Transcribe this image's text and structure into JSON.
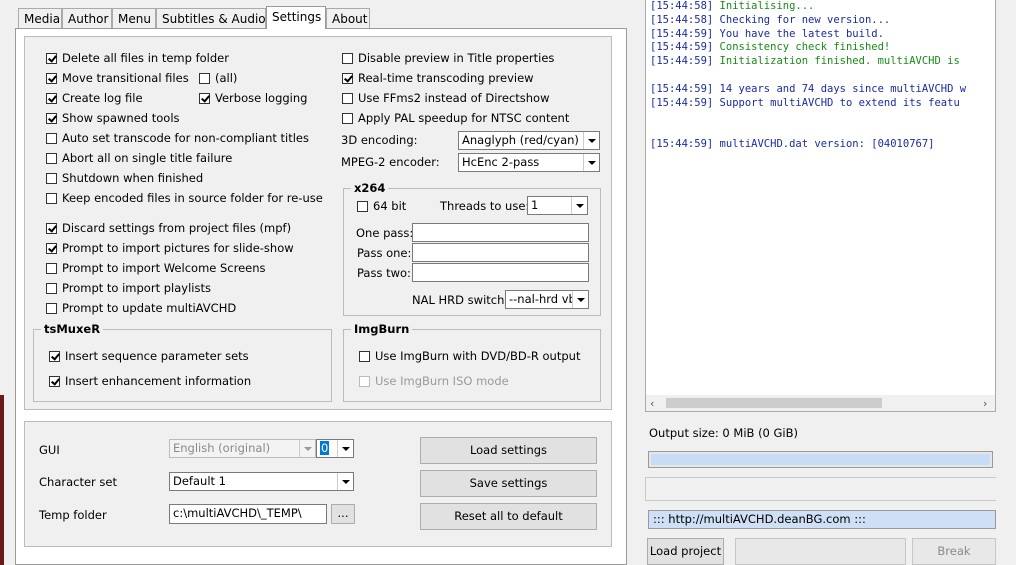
{
  "tabs": [
    "Media",
    "Author",
    "Menu",
    "Subtitles & Audio",
    "Settings",
    "About"
  ],
  "active_tab": "Settings",
  "options_left": [
    {
      "label": "Delete all files in temp folder",
      "checked": true
    },
    {
      "label": "Move transitional files",
      "checked": true
    },
    {
      "label": "Create log file",
      "checked": true
    },
    {
      "label": "Show spawned tools",
      "checked": true
    },
    {
      "label": "Auto set transcode for non-compliant titles",
      "checked": false
    },
    {
      "label": "Abort all on single title failure",
      "checked": false
    },
    {
      "label": "Shutdown when finished",
      "checked": false
    },
    {
      "label": "Keep encoded files in source folder for re-use",
      "checked": false
    },
    {
      "label": "Discard settings from project files (mpf)",
      "checked": true
    },
    {
      "label": "Prompt to import pictures for slide-show",
      "checked": true
    },
    {
      "label": "Prompt to import Welcome Screens",
      "checked": false
    },
    {
      "label": "Prompt to import playlists",
      "checked": false
    },
    {
      "label": "Prompt to update multiAVCHD",
      "checked": false
    }
  ],
  "all_option": {
    "label": "(all)",
    "checked": false
  },
  "verbose_option": {
    "label": "Verbose logging",
    "checked": true
  },
  "options_right": [
    {
      "label": "Disable preview in Title properties",
      "checked": false
    },
    {
      "label": "Real-time transcoding preview",
      "checked": true
    },
    {
      "label": "Use FFms2 instead of Directshow",
      "checked": false
    },
    {
      "label": "Apply PAL speedup for NTSC content",
      "checked": false
    }
  ],
  "encoding_3d": {
    "label": "3D encoding:",
    "value": "Anaglyph (red/cyan)"
  },
  "mpeg2_encoder": {
    "label": "MPEG-2 encoder:",
    "value": "HcEnc 2-pass"
  },
  "x264": {
    "title": "x264",
    "bit64": {
      "label": "64 bit",
      "checked": false
    },
    "threads_label": "Threads to use:",
    "threads_value": "1",
    "one_pass_label": "One pass:",
    "one_pass_value": "",
    "pass_one_label": "Pass one:",
    "pass_one_value": "",
    "pass_two_label": "Pass two:",
    "pass_two_value": "",
    "nal_label": "NAL HRD switch:",
    "nal_value": "--nal-hrd vbr"
  },
  "tsmuxer": {
    "title": "tsMuxeR",
    "items": [
      {
        "label": "Insert sequence parameter sets",
        "checked": true
      },
      {
        "label": "Insert enhancement information",
        "checked": true
      }
    ]
  },
  "imgburn": {
    "title": "ImgBurn",
    "items": [
      {
        "label": "Use ImgBurn with DVD/BD-R output",
        "checked": false,
        "disabled": false
      },
      {
        "label": "Use ImgBurn ISO mode",
        "checked": false,
        "disabled": true
      }
    ]
  },
  "bottom": {
    "gui_label": "GUI",
    "gui_value": "English (original)",
    "gui_num": "0",
    "charset_label": "Character set",
    "charset_value": "Default 1",
    "temp_label": "Temp folder",
    "temp_value": "c:\\multiAVCHD\\_TEMP\\",
    "browse_label": "...",
    "load_settings": "Load settings",
    "save_settings": "Save settings",
    "reset_default": "Reset all to default"
  },
  "log_lines": [
    {
      "time": "[15:44:58]",
      "text": "Initialising...",
      "color": "green"
    },
    {
      "time": "[15:44:58]",
      "text": "Checking for new version...",
      "color": "blue"
    },
    {
      "time": "[15:44:59]",
      "text": "You have the latest build.",
      "color": "blue"
    },
    {
      "time": "[15:44:59]",
      "text": "Consistency check finished!",
      "color": "green"
    },
    {
      "time": "[15:44:59]",
      "text": "Initialization finished. multiAVCHD is",
      "color": "green"
    },
    {
      "time": "",
      "text": "",
      "color": "blue"
    },
    {
      "time": "[15:44:59]",
      "text": "14 years and 74 days since multiAVCHD w",
      "color": "blue"
    },
    {
      "time": "[15:44:59]",
      "text": "Support multiAVCHD to extend its featu",
      "color": "blue"
    },
    {
      "time": "",
      "text": "",
      "color": "blue"
    },
    {
      "time": "",
      "text": "",
      "color": "blue"
    },
    {
      "time": "[15:44:59]",
      "text": "multiAVCHD.dat version: [04010767]",
      "color": "blue"
    }
  ],
  "output_size": "Output size: 0 MiB (0 GiB)",
  "url": "::: http://multiAVCHD.deanBG.com :::",
  "load_project": "Load project",
  "break_label": "Break",
  "colors": {
    "log_blue": "#1a2ca0",
    "log_green": "#1a8a1a",
    "progress": "#c7dcf5",
    "url_bg": "#cfe0f6"
  }
}
